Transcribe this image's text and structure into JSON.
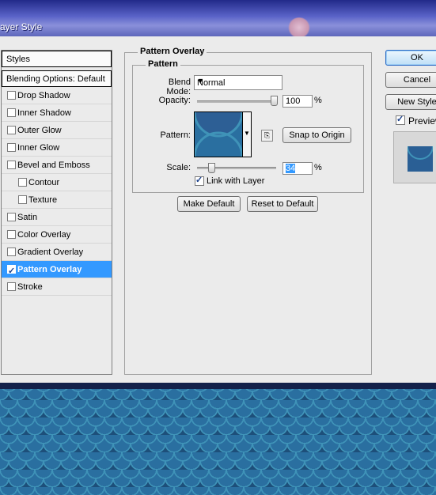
{
  "window": {
    "title": "ayer Style"
  },
  "styles_panel": {
    "header": "Styles",
    "blending": "Blending Options: Default",
    "items": [
      {
        "label": "Drop Shadow",
        "checked": false,
        "sub": false,
        "active": false
      },
      {
        "label": "Inner Shadow",
        "checked": false,
        "sub": false,
        "active": false
      },
      {
        "label": "Outer Glow",
        "checked": false,
        "sub": false,
        "active": false
      },
      {
        "label": "Inner Glow",
        "checked": false,
        "sub": false,
        "active": false
      },
      {
        "label": "Bevel and Emboss",
        "checked": false,
        "sub": false,
        "active": false
      },
      {
        "label": "Contour",
        "checked": false,
        "sub": true,
        "active": false
      },
      {
        "label": "Texture",
        "checked": false,
        "sub": true,
        "active": false
      },
      {
        "label": "Satin",
        "checked": false,
        "sub": false,
        "active": false
      },
      {
        "label": "Color Overlay",
        "checked": false,
        "sub": false,
        "active": false
      },
      {
        "label": "Gradient Overlay",
        "checked": false,
        "sub": false,
        "active": false
      },
      {
        "label": "Pattern Overlay",
        "checked": true,
        "sub": false,
        "active": true
      },
      {
        "label": "Stroke",
        "checked": false,
        "sub": false,
        "active": false
      }
    ]
  },
  "pattern_overlay": {
    "group_title": "Pattern Overlay",
    "subgroup_title": "Pattern",
    "blend_mode_label": "Blend Mode:",
    "blend_mode_value": "Normal",
    "opacity_label": "Opacity:",
    "opacity_value": "100",
    "opacity_unit": "%",
    "opacity_fraction": 1.0,
    "pattern_label": "Pattern:",
    "snap_button": "Snap to Origin",
    "scale_label": "Scale:",
    "scale_value": "34",
    "scale_unit": "%",
    "scale_fraction": 0.34,
    "link_label": "Link with Layer",
    "link_checked": true,
    "make_default_button": "Make Default",
    "reset_default_button": "Reset to Default"
  },
  "right_panel": {
    "ok_button": "OK",
    "cancel_button": "Cancel",
    "new_style_button": "New Style",
    "preview_label": "Preview",
    "preview_checked": true
  },
  "colors": {
    "pattern_blue": "#2d5f95",
    "pattern_teal": "#3f93b8",
    "selection": "#3399ff"
  }
}
